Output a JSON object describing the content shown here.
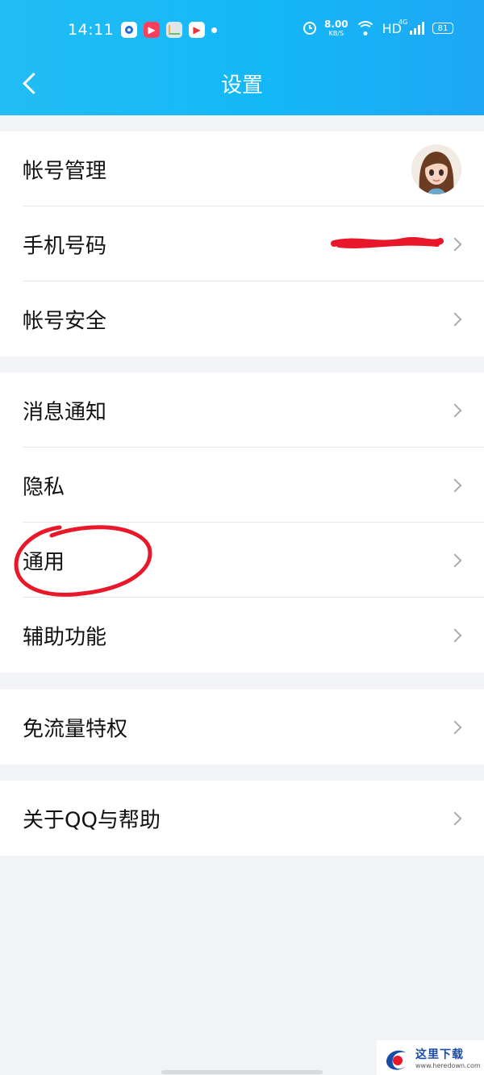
{
  "status_bar": {
    "time": "14:11",
    "speed_value": "8.00",
    "speed_unit": "KB/S",
    "hd": "HD",
    "network": "4G",
    "battery": "81"
  },
  "header": {
    "title": "设置"
  },
  "sections": [
    {
      "items": [
        {
          "label": "帐号管理",
          "trailing": "avatar"
        },
        {
          "label": "手机号码",
          "trailing": "chevron",
          "note": "redacted"
        },
        {
          "label": "帐号安全",
          "trailing": "chevron"
        }
      ]
    },
    {
      "items": [
        {
          "label": "消息通知",
          "trailing": "chevron"
        },
        {
          "label": "隐私",
          "trailing": "chevron"
        },
        {
          "label": "通用",
          "trailing": "chevron",
          "highlight": "red-circle"
        },
        {
          "label": "辅助功能",
          "trailing": "chevron"
        }
      ]
    },
    {
      "items": [
        {
          "label": "免流量特权",
          "trailing": "chevron"
        }
      ]
    },
    {
      "items": [
        {
          "label": "关于QQ与帮助",
          "trailing": "chevron"
        }
      ]
    }
  ],
  "watermark": {
    "title": "这里下载",
    "url": "www.heredown.com"
  },
  "colors": {
    "header": "#13b8f7",
    "annotation": "#e8182a",
    "background": "#f2f3f7"
  }
}
